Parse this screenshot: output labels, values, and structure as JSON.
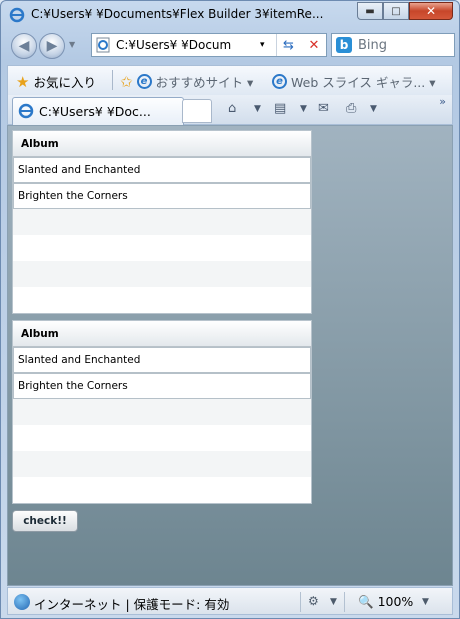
{
  "window": {
    "title": "C:¥Users¥        ¥Documents¥Flex Builder 3¥itemRe..."
  },
  "caption": {
    "minimize": "▬",
    "maximize": "□",
    "close": "✕"
  },
  "address": {
    "url": "C:¥Users¥              ¥Docum",
    "dropdown_glyph": "▾"
  },
  "search": {
    "provider": "Bing"
  },
  "favorites": {
    "favorites_label": "お気に入り",
    "items": [
      {
        "label": "おすすめサイト ▾"
      },
      {
        "label": "Web スライス ギャラ... ▾"
      }
    ]
  },
  "tabs": [
    {
      "label": "C:¥Users¥         ¥Doc..."
    }
  ],
  "grids": [
    {
      "header": "Album",
      "rows": [
        "Slanted and Enchanted",
        "Brighten the Corners"
      ]
    },
    {
      "header": "Album",
      "rows": [
        "Slanted and Enchanted",
        "Brighten the Corners"
      ]
    }
  ],
  "check_button": {
    "label": "check!!"
  },
  "status": {
    "zone": "インターネット | 保護モード: 有効",
    "zoom": "100%"
  }
}
